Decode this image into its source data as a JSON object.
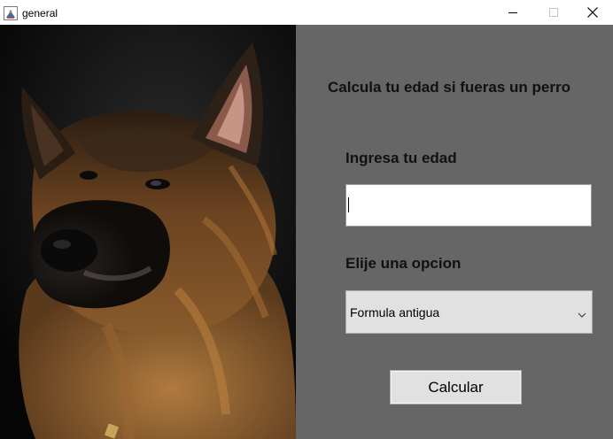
{
  "window": {
    "title": "general",
    "controls": [
      "minimize",
      "maximize",
      "close"
    ]
  },
  "photo": {
    "subject": "German Shepherd dog portrait on dark background"
  },
  "form": {
    "heading": "Calcula tu edad si fueras un perro",
    "age_label": "Ingresa tu edad",
    "age_value": "",
    "option_label": "Elije una opcion",
    "selected_option": "Formula antigua",
    "calculate_label": "Calcular"
  },
  "colors": {
    "form_background": "#666666",
    "button_background": "#e1e1e1",
    "photo_background": "#0c0c0c"
  }
}
